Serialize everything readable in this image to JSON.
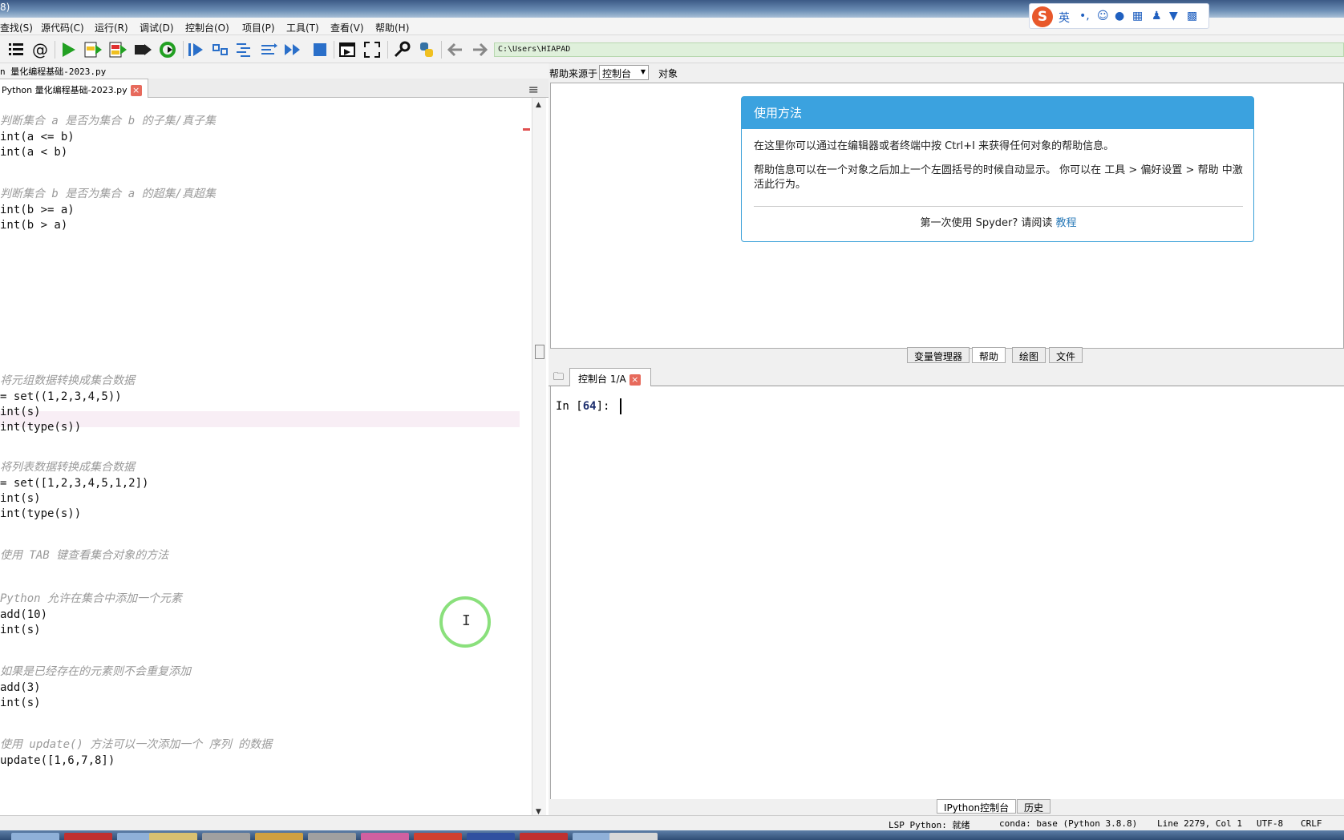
{
  "window": {
    "title_fragment": "8)"
  },
  "menu": [
    "查找(S)",
    "源代码(C)",
    "运行(R)",
    "调试(D)",
    "控制台(O)",
    "项目(P)",
    "工具(T)",
    "查看(V)",
    "帮助(H)"
  ],
  "ime": {
    "logo": "S",
    "lang": "英",
    "punct": "•,"
  },
  "toolbar": {
    "path": "C:\\Users\\HIAPAD"
  },
  "editor": {
    "filename_label": "n 量化编程基础-2023.py",
    "tab_label": "Python 量化编程基础-2023.py",
    "close_glyph": "×",
    "lines": [
      {
        "text": "判断集合 a 是否为集合 b 的子集/真子集",
        "comment": true
      },
      {
        "text": "int(a <= b)",
        "comment": false
      },
      {
        "text": "int(a < b)",
        "comment": false
      },
      {
        "text": "判断集合 b 是否为集合 a 的超集/真超集",
        "comment": true
      },
      {
        "text": "int(b >= a)",
        "comment": false
      },
      {
        "text": "int(b > a)",
        "comment": false
      },
      {
        "text": "将元组数据转换成集合数据",
        "comment": true
      },
      {
        "text": "= set((1,2,3,4,5))",
        "comment": false
      },
      {
        "text": "int(s)",
        "comment": false
      },
      {
        "text": "int(type(s))",
        "comment": false
      },
      {
        "text": "将列表数据转换成集合数据",
        "comment": true
      },
      {
        "text": "= set([1,2,3,4,5,1,2])",
        "comment": false
      },
      {
        "text": "int(s)",
        "comment": false
      },
      {
        "text": "int(type(s))",
        "comment": false
      },
      {
        "text": "使用 TAB 键查看集合对象的方法",
        "comment": true
      },
      {
        "text": "Python 允许在集合中添加一个元素",
        "comment": true
      },
      {
        "text": "add(10)",
        "comment": false
      },
      {
        "text": "int(s)",
        "comment": false
      },
      {
        "text": "如果是已经存在的元素则不会重复添加",
        "comment": true
      },
      {
        "text": "add(3)",
        "comment": false
      },
      {
        "text": "int(s)",
        "comment": false
      },
      {
        "text": "使用 update() 方法可以一次添加一个 序列 的数据",
        "comment": true
      },
      {
        "text": "update([1,6,7,8])",
        "comment": false
      }
    ]
  },
  "help": {
    "source_label": "帮助来源于",
    "source_value": "控制台",
    "object_label": "对象",
    "card_title": "使用方法",
    "para1": "在这里你可以通过在编辑器或者终端中按 Ctrl+I 来获得任何对象的帮助信息。",
    "para2": "帮助信息可以在一个对象之后加上一个左圆括号的时候自动显示。 你可以在 工具 > 偏好设置 > 帮助 中激活此行为。",
    "first_use": "第一次使用 Spyder? 请阅读",
    "tutorial_link": "教程"
  },
  "pane_tabs": [
    "变量管理器",
    "帮助",
    "绘图",
    "文件"
  ],
  "console": {
    "tab_label": "控制台 1/A",
    "prompt_prefix": "In [",
    "prompt_number": "64",
    "prompt_suffix": "]: "
  },
  "bottom_tabs": [
    "IPython控制台",
    "历史"
  ],
  "status": {
    "lsp": "LSP Python: 就绪",
    "conda": "conda: base (Python 3.8.8)",
    "position": "Line 2279, Col 1",
    "encoding": "UTF-8",
    "eol": "CRLF"
  },
  "colors": {
    "accent": "#3ba2df",
    "comment": "#9a9a9a",
    "current_line": "#f8eef5",
    "path_bg": "#dff0db"
  }
}
